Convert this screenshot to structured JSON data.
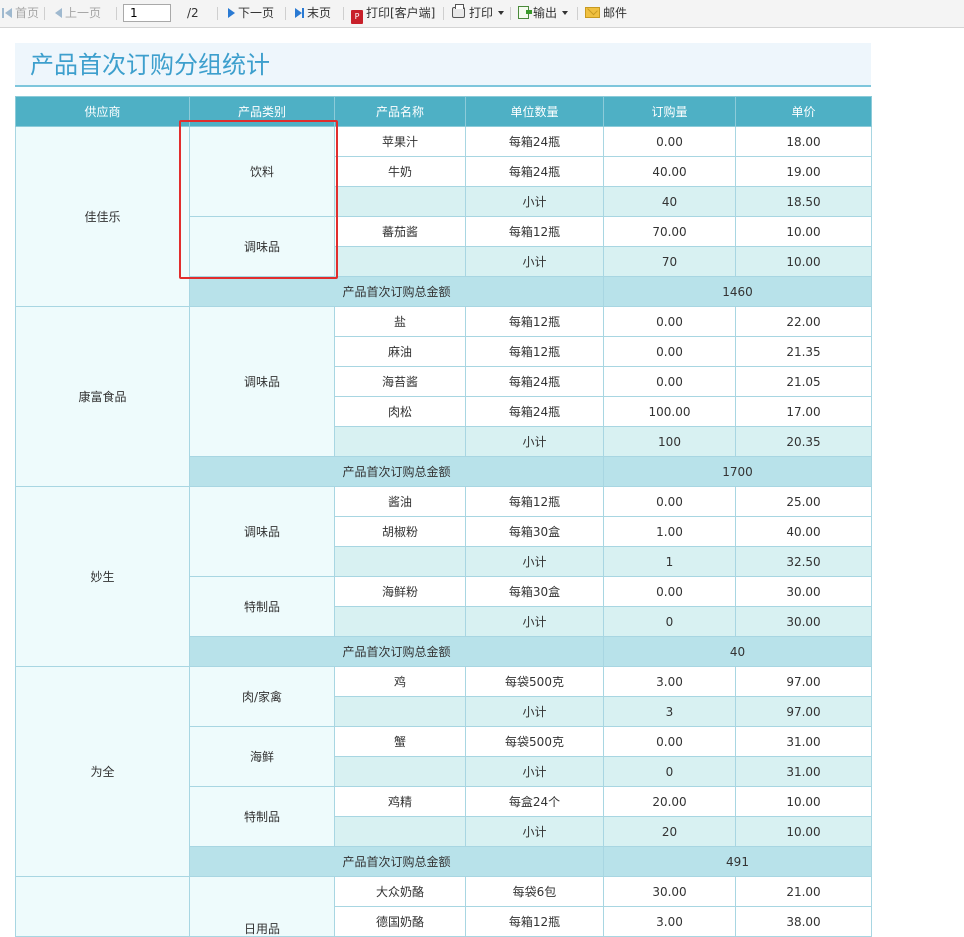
{
  "toolbar": {
    "first": "首页",
    "prev": "上一页",
    "page_value": "1",
    "page_total": "/2",
    "next": "下一页",
    "last": "末页",
    "print_client": "打印[客户端]",
    "print": "打印",
    "export": "输出",
    "mail": "邮件"
  },
  "report": {
    "title": "产品首次订购分组统计",
    "headers": [
      "供应商",
      "产品类别",
      "产品名称",
      "单位数量",
      "订购量",
      "单价"
    ],
    "subtotal_label": "小计",
    "total_label": "产品首次订购总金额",
    "groups": [
      {
        "supplier": "佳佳乐",
        "categories": [
          {
            "name": "饮料",
            "items": [
              {
                "product": "苹果汁",
                "unit": "每箱24瓶",
                "qty": "0.00",
                "price": "18.00"
              },
              {
                "product": "牛奶",
                "unit": "每箱24瓶",
                "qty": "40.00",
                "price": "19.00"
              }
            ],
            "subtotal_qty": "40",
            "subtotal_price": "18.50"
          },
          {
            "name": "调味品",
            "items": [
              {
                "product": "蕃茄酱",
                "unit": "每箱12瓶",
                "qty": "70.00",
                "price": "10.00"
              }
            ],
            "subtotal_qty": "70",
            "subtotal_price": "10.00"
          }
        ],
        "total": "1460"
      },
      {
        "supplier": "康富食品",
        "categories": [
          {
            "name": "调味品",
            "items": [
              {
                "product": "盐",
                "unit": "每箱12瓶",
                "qty": "0.00",
                "price": "22.00"
              },
              {
                "product": "麻油",
                "unit": "每箱12瓶",
                "qty": "0.00",
                "price": "21.35"
              },
              {
                "product": "海苔酱",
                "unit": "每箱24瓶",
                "qty": "0.00",
                "price": "21.05"
              },
              {
                "product": "肉松",
                "unit": "每箱24瓶",
                "qty": "100.00",
                "price": "17.00"
              }
            ],
            "subtotal_qty": "100",
            "subtotal_price": "20.35"
          }
        ],
        "total": "1700"
      },
      {
        "supplier": "妙生",
        "categories": [
          {
            "name": "调味品",
            "items": [
              {
                "product": "酱油",
                "unit": "每箱12瓶",
                "qty": "0.00",
                "price": "25.00"
              },
              {
                "product": "胡椒粉",
                "unit": "每箱30盒",
                "qty": "1.00",
                "price": "40.00"
              }
            ],
            "subtotal_qty": "1",
            "subtotal_price": "32.50"
          },
          {
            "name": "特制品",
            "items": [
              {
                "product": "海鲜粉",
                "unit": "每箱30盒",
                "qty": "0.00",
                "price": "30.00"
              }
            ],
            "subtotal_qty": "0",
            "subtotal_price": "30.00"
          }
        ],
        "total": "40"
      },
      {
        "supplier": "为全",
        "categories": [
          {
            "name": "肉/家禽",
            "items": [
              {
                "product": "鸡",
                "unit": "每袋500克",
                "qty": "3.00",
                "price": "97.00"
              }
            ],
            "subtotal_qty": "3",
            "subtotal_price": "97.00"
          },
          {
            "name": "海鲜",
            "items": [
              {
                "product": "蟹",
                "unit": "每袋500克",
                "qty": "0.00",
                "price": "31.00"
              }
            ],
            "subtotal_qty": "0",
            "subtotal_price": "31.00"
          },
          {
            "name": "特制品",
            "items": [
              {
                "product": "鸡精",
                "unit": "每盒24个",
                "qty": "20.00",
                "price": "10.00"
              }
            ],
            "subtotal_qty": "20",
            "subtotal_price": "10.00"
          }
        ],
        "total": "491"
      },
      {
        "supplier": "",
        "categories": [
          {
            "name": "日用品",
            "items": [
              {
                "product": "大众奶酪",
                "unit": "每袋6包",
                "qty": "30.00",
                "price": "21.00"
              },
              {
                "product": "德国奶酪",
                "unit": "每箱12瓶",
                "qty": "3.00",
                "price": "38.00"
              }
            ]
          }
        ]
      }
    ]
  }
}
